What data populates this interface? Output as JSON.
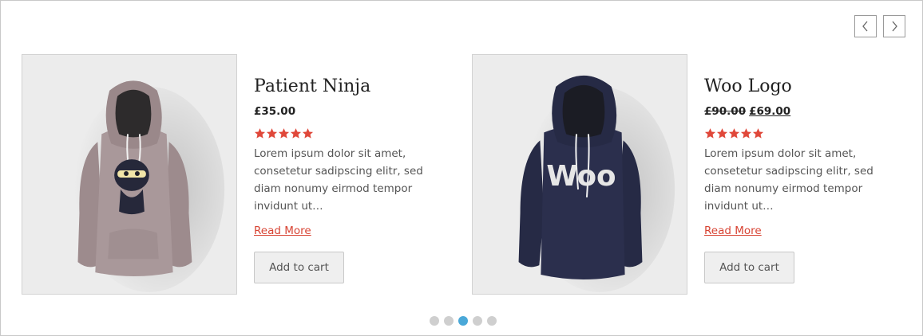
{
  "carousel": {
    "prev_icon": "chevron-left-icon",
    "next_icon": "chevron-right-icon",
    "dots_count": 5,
    "active_dot": 3
  },
  "products": [
    {
      "title": "Patient Ninja",
      "price": "£35.00",
      "old_price": "",
      "rating": 5,
      "description": "Lorem ipsum dolor sit amet, consetetur sadipscing elitr, sed diam nonumy eirmod tempor invidunt ut…",
      "read_more": "Read More",
      "add_to_cart": "Add to cart",
      "hoodie_color": "#a9989a",
      "image_icon": "ninja-hoodie-image"
    },
    {
      "title": "Woo Logo",
      "price": "£69.00",
      "old_price": "£90.00",
      "rating": 5,
      "description": "Lorem ipsum dolor sit amet, consetetur sadipscing elitr, sed diam nonumy eirmod tempor invidunt ut…",
      "read_more": "Read More",
      "add_to_cart": "Add to cart",
      "hoodie_color": "#2b2f4d",
      "image_icon": "woo-hoodie-image",
      "logo_text": "Woo"
    }
  ],
  "colors": {
    "accent": "#d84434",
    "star": "#e0483a",
    "active_dot": "#4aa8d8"
  }
}
